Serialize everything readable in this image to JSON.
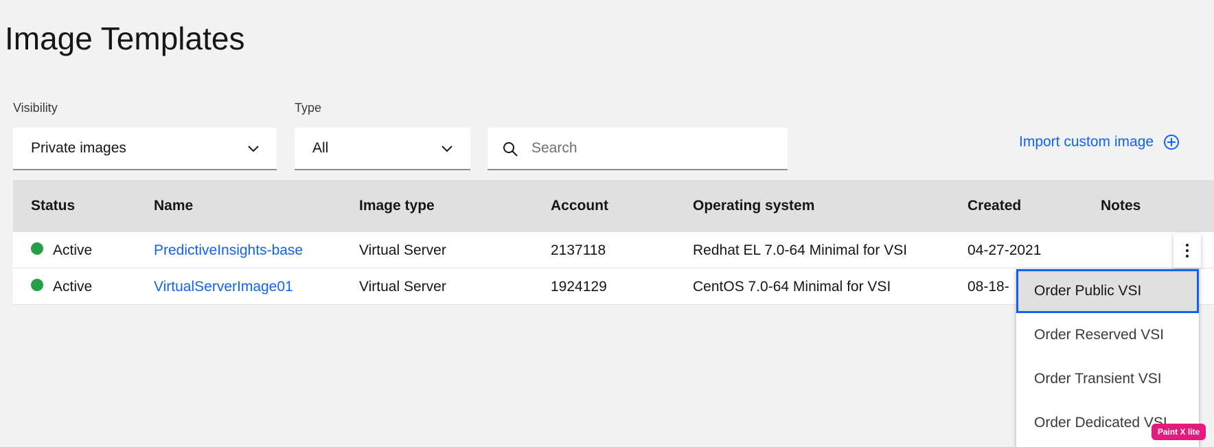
{
  "page": {
    "title": "Image Templates"
  },
  "filters": {
    "visibility_label": "Visibility",
    "visibility_value": "Private images",
    "type_label": "Type",
    "type_value": "All",
    "search_placeholder": "Search"
  },
  "actions": {
    "import_label": "Import custom image"
  },
  "table": {
    "headers": [
      "Status",
      "Name",
      "Image type",
      "Account",
      "Operating system",
      "Created",
      "Notes"
    ],
    "rows": [
      {
        "status": "Active",
        "name": "PredictiveInsights-base",
        "image_type": "Virtual Server",
        "account": "2137118",
        "os": "Redhat EL 7.0-64 Minimal for VSI",
        "created": "04-27-2021",
        "notes": ""
      },
      {
        "status": "Active",
        "name": "VirtualServerImage01",
        "image_type": "Virtual Server",
        "account": "1924129",
        "os": "CentOS 7.0-64 Minimal for VSI",
        "created": "08-18-",
        "notes": ""
      }
    ]
  },
  "overflow_menu": {
    "items": [
      "Order Public VSI",
      "Order Reserved VSI",
      "Order Transient VSI",
      "Order Dedicated VSI"
    ],
    "selected_index": 0
  },
  "watermark": "Paint X lite",
  "colors": {
    "accent": "#0f62fe",
    "status_active": "#24a148",
    "header_bg": "#e0e0e0",
    "page_bg": "#f2f2f2"
  },
  "icons": {
    "dropdown": "chevron-down-icon",
    "search": "search-icon",
    "import": "add-circle-icon",
    "overflow": "overflow-menu-vertical-icon"
  }
}
